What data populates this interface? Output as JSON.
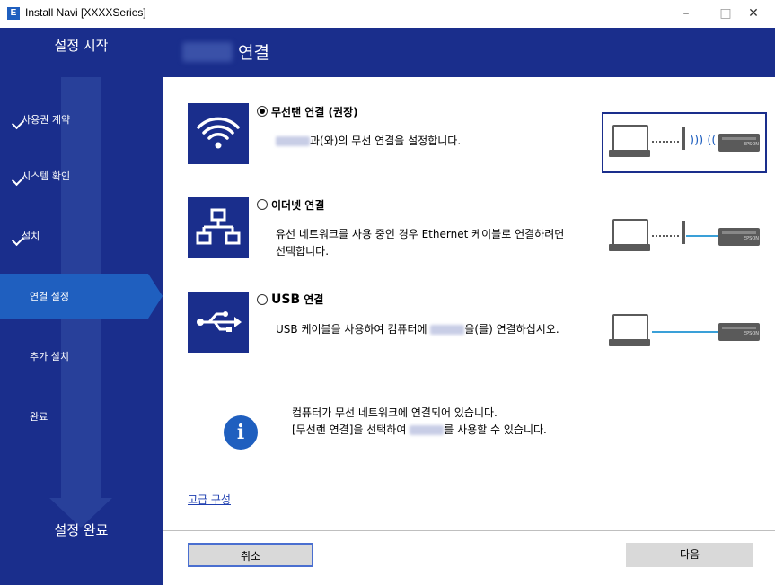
{
  "window": {
    "title": "Install Navi [XXXXSeries]",
    "app_icon": "E",
    "minimize": "–",
    "maximize": "□",
    "close": "✕"
  },
  "sidebar": {
    "top_label": "설정 시작",
    "bottom_label": "설정 완료",
    "steps": [
      {
        "label": "사용권 계약",
        "done": true
      },
      {
        "label": "시스템 확인",
        "done": true
      },
      {
        "label": "설치",
        "done": true
      },
      {
        "label": "연결 설정",
        "active": true
      },
      {
        "label": "추가 설치"
      },
      {
        "label": "완료"
      }
    ]
  },
  "header": {
    "title": "연결"
  },
  "options": [
    {
      "title": "무선랜 연결 (권장)",
      "selected": true,
      "icon": "wifi-icon",
      "desc_suffix": "과(와)의 무선 연결을 설정합니다."
    },
    {
      "title": "이더넷 연결",
      "selected": false,
      "icon": "ethernet-icon",
      "desc_line1": "유선 네트워크를 사용 중인 경우 Ethernet 케이블로 연결하려면",
      "desc_line2": "선택합니다."
    },
    {
      "title_bold": "USB",
      "title_rest": " 연결",
      "selected": false,
      "icon": "usb-icon",
      "desc_prefix": "USB 케이블을 사용하여 컴퓨터에 ",
      "desc_suffix": "을(를) 연결하십시오."
    }
  ],
  "info": {
    "icon": "info-icon",
    "line1": "컴퓨터가 무선 네트워크에 연결되어 있습니다.",
    "line2_prefix": "[무선랜 연결]을 선택하여 ",
    "line2_suffix": "를 사용할 수 있습니다."
  },
  "advanced_link": "고급 구성",
  "buttons": {
    "cancel": "취소",
    "next": "다음"
  },
  "printer_label": "EPSON",
  "colors": {
    "navy": "#1a2e8c",
    "accent": "#1f5fbf",
    "link": "#1f3fb0"
  }
}
